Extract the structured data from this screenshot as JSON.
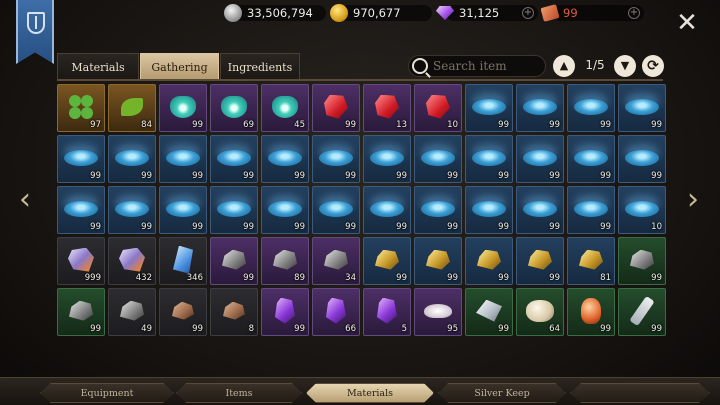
{
  "currencies": [
    {
      "id": "silver",
      "value": "33,506,794",
      "icon": "silver-coin-icon"
    },
    {
      "id": "gold",
      "value": "970,677",
      "icon": "gold-coin-icon"
    },
    {
      "id": "gem",
      "value": "31,125",
      "icon": "purple-gem-icon"
    },
    {
      "id": "ticket",
      "value": "99",
      "icon": "red-ticket-icon"
    }
  ],
  "tabs": [
    "Materials",
    "Gathering",
    "Ingredients"
  ],
  "active_tab": "Gathering",
  "search": {
    "placeholder": "Search item"
  },
  "pager": {
    "label": "1/5"
  },
  "items": [
    [
      "clover",
      "gold",
      "97"
    ],
    [
      "leaf",
      "gold",
      "84"
    ],
    [
      "teal",
      "purple",
      "99"
    ],
    [
      "teal",
      "purple",
      "69"
    ],
    [
      "teal",
      "purple",
      "45"
    ],
    [
      "ruby",
      "purple",
      "99"
    ],
    [
      "ruby",
      "purple",
      "13"
    ],
    [
      "ruby",
      "purple",
      "10"
    ],
    [
      "water",
      "blue",
      "99"
    ],
    [
      "water",
      "blue",
      "99"
    ],
    [
      "water",
      "blue",
      "99"
    ],
    [
      "water",
      "blue",
      "99"
    ],
    [
      "water",
      "blue",
      "99"
    ],
    [
      "water",
      "blue",
      "99"
    ],
    [
      "water",
      "blue",
      "99"
    ],
    [
      "water",
      "blue",
      "99"
    ],
    [
      "water",
      "blue",
      "99"
    ],
    [
      "water",
      "blue",
      "99"
    ],
    [
      "water",
      "blue",
      "99"
    ],
    [
      "water",
      "blue",
      "99"
    ],
    [
      "water",
      "blue",
      "99"
    ],
    [
      "water",
      "blue",
      "99"
    ],
    [
      "water",
      "blue",
      "99"
    ],
    [
      "water",
      "blue",
      "99"
    ],
    [
      "water",
      "blue",
      "99"
    ],
    [
      "water",
      "blue",
      "99"
    ],
    [
      "water",
      "blue",
      "99"
    ],
    [
      "water",
      "blue",
      "99"
    ],
    [
      "water",
      "blue",
      "99"
    ],
    [
      "water",
      "blue",
      "99"
    ],
    [
      "water",
      "blue",
      "99"
    ],
    [
      "water",
      "blue",
      "99"
    ],
    [
      "water",
      "blue",
      "99"
    ],
    [
      "water",
      "blue",
      "99"
    ],
    [
      "water",
      "blue",
      "99"
    ],
    [
      "water",
      "blue",
      "10"
    ],
    [
      "crystal-o",
      "dark",
      "999"
    ],
    [
      "crystal-o",
      "dark",
      "432"
    ],
    [
      "crystal-b",
      "dark",
      "346"
    ],
    [
      "ore-s",
      "purple",
      "99"
    ],
    [
      "ore-s",
      "purple",
      "89"
    ],
    [
      "ore-s",
      "purple",
      "34"
    ],
    [
      "ore-g",
      "blue",
      "99"
    ],
    [
      "ore-g",
      "blue",
      "99"
    ],
    [
      "ore-g",
      "blue",
      "99"
    ],
    [
      "ore-g",
      "blue",
      "99"
    ],
    [
      "ore-g",
      "blue",
      "81"
    ],
    [
      "ore-s",
      "green",
      "99"
    ],
    [
      "ore-s",
      "green",
      "99"
    ],
    [
      "ore-s",
      "dark",
      "49"
    ],
    [
      "ore-c",
      "dark",
      "99"
    ],
    [
      "ore-c",
      "dark",
      "8"
    ],
    [
      "ore-p",
      "purple",
      "99"
    ],
    [
      "ore-p",
      "purple",
      "66"
    ],
    [
      "ore-p",
      "purple",
      "5"
    ],
    [
      "salt",
      "purple",
      "95"
    ],
    [
      "shard",
      "green",
      "99"
    ],
    [
      "lump",
      "green",
      "64"
    ],
    [
      "amber",
      "green",
      "99"
    ],
    [
      "vial",
      "green",
      "99"
    ]
  ],
  "bottom_tabs": [
    "Equipment",
    "Items",
    "Materials",
    "Silver Keep"
  ],
  "active_bottom_tab": "Materials"
}
